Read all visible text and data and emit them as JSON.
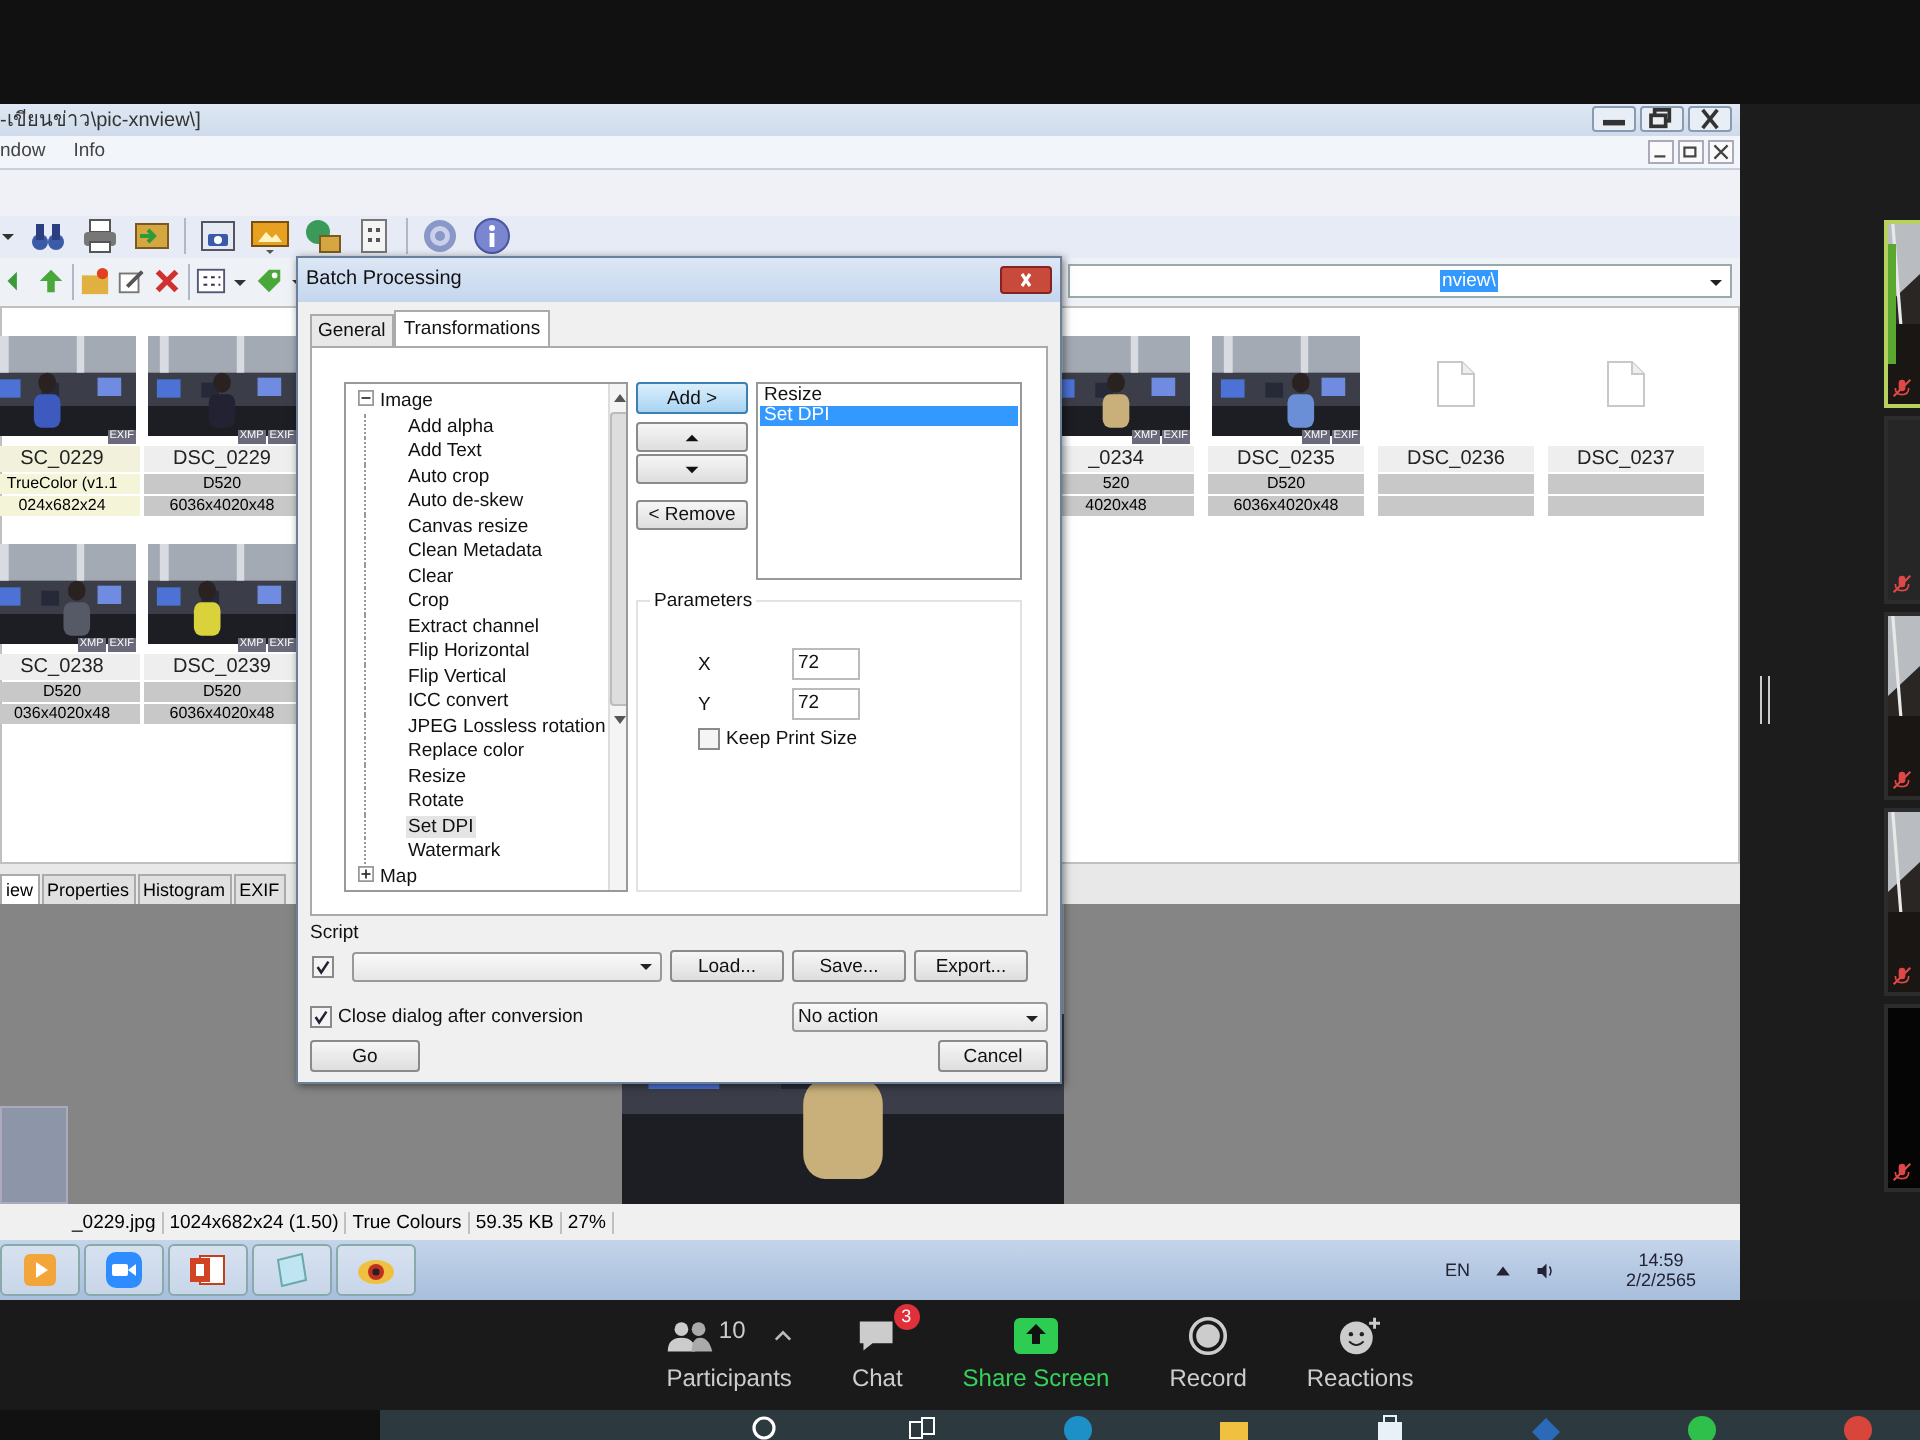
{
  "window": {
    "title": "-เขียนข่าว\\pic-xnview\\]"
  },
  "menu": [
    {
      "label": "ndow"
    },
    {
      "label": "Info"
    }
  ],
  "path": {
    "value": "nview\\"
  },
  "thumbnails_left": [
    {
      "name": "SC_0229",
      "line1": "TrueColor (v1.1",
      "line2": "024x682x24",
      "selected": true,
      "badges": [
        "EXIF"
      ]
    },
    {
      "name": "DSC_0229",
      "line1": "D520",
      "line2": "6036x4020x48",
      "selected": false,
      "badges": [
        "XMP",
        "EXIF"
      ]
    },
    {
      "name": "SC_0238",
      "line1": "D520",
      "line2": "036x4020x48",
      "selected": false,
      "badges": [
        "XMP",
        "EXIF"
      ]
    },
    {
      "name": "DSC_0239",
      "line1": "D520",
      "line2": "6036x4020x48",
      "selected": false,
      "badges": [
        "XMP",
        "EXIF"
      ]
    }
  ],
  "thumbnails_right": [
    {
      "name": "_0234",
      "line1": "520",
      "line2": "4020x48",
      "selected": false,
      "badges": [
        "XMP",
        "EXIF"
      ]
    },
    {
      "name": "DSC_0235",
      "line1": "D520",
      "line2": "6036x4020x48",
      "selected": false,
      "badges": [
        "XMP",
        "EXIF"
      ]
    },
    {
      "name": "DSC_0236",
      "kind": "file",
      "selected": false
    },
    {
      "name": "DSC_0237",
      "kind": "file",
      "selected": false
    }
  ],
  "panel_tabs": [
    {
      "label": "iew",
      "selected": true
    },
    {
      "label": "Properties",
      "selected": false
    },
    {
      "label": "Histogram",
      "selected": false
    },
    {
      "label": "EXIF",
      "selected": false
    }
  ],
  "status_bar": [
    "_0229.jpg",
    "1024x682x24 (1.50)",
    "True Colours",
    "59.35 KB",
    "27%"
  ],
  "taskbar": {
    "apps": [
      {
        "kind": "media"
      },
      {
        "kind": "meeting"
      },
      {
        "kind": "slides"
      },
      {
        "kind": "notes"
      },
      {
        "kind": "viewer"
      }
    ],
    "language": "EN",
    "time": "14:59",
    "date": "2/2/2565"
  },
  "dialog": {
    "title": "Batch Processing",
    "tabs": [
      {
        "label": "General",
        "selected": false
      },
      {
        "label": "Transformations",
        "selected": true
      }
    ],
    "tree": [
      {
        "label": "Image",
        "expanded": true,
        "children": [
          {
            "label": "Add alpha",
            "selected": false
          },
          {
            "label": "Add Text",
            "selected": false
          },
          {
            "label": "Auto crop",
            "selected": false
          },
          {
            "label": "Auto de-skew",
            "selected": false
          },
          {
            "label": "Canvas resize",
            "selected": false
          },
          {
            "label": "Clean Metadata",
            "selected": false
          },
          {
            "label": "Clear",
            "selected": false
          },
          {
            "label": "Crop",
            "selected": false
          },
          {
            "label": "Extract channel",
            "selected": false
          },
          {
            "label": "Flip Horizontal",
            "selected": false
          },
          {
            "label": "Flip Vertical",
            "selected": false
          },
          {
            "label": "ICC convert",
            "selected": false
          },
          {
            "label": "JPEG Lossless rotation",
            "selected": false
          },
          {
            "label": "Replace color",
            "selected": false
          },
          {
            "label": "Resize",
            "selected": false
          },
          {
            "label": "Rotate",
            "selected": false
          },
          {
            "label": "Set DPI",
            "selected": true
          },
          {
            "label": "Watermark",
            "selected": false
          }
        ]
      },
      {
        "label": "Map",
        "expanded": false
      }
    ],
    "add": "Add >",
    "remove": "< Remove",
    "queue": [
      {
        "label": "Resize",
        "selected": false
      },
      {
        "label": "Set DPI",
        "selected": true
      }
    ],
    "parameters": {
      "title": "Parameters",
      "fields": [
        {
          "label": "X",
          "value": "72"
        },
        {
          "label": "Y",
          "value": "72"
        }
      ],
      "keep_print_size": {
        "label": "Keep Print Size",
        "checked": false
      }
    },
    "script": {
      "label": "Script",
      "checked": true,
      "buttons": [
        "Load...",
        "Save...",
        "Export..."
      ]
    },
    "close_after": {
      "label": "Close dialog after conversion",
      "checked": true
    },
    "action": {
      "value": "No action"
    },
    "go": "Go",
    "cancel": "Cancel"
  },
  "zoom_toolbar": [
    {
      "kind": "participants",
      "label": "Participants",
      "count": "10"
    },
    {
      "kind": "chat",
      "label": "Chat",
      "badge": "3"
    },
    {
      "kind": "share",
      "label": "Share Screen"
    },
    {
      "kind": "record",
      "label": "Record"
    },
    {
      "kind": "reactions",
      "label": "Reactions"
    }
  ],
  "video_tiles": [
    {
      "kind": "picture",
      "active": true,
      "muted": true
    },
    {
      "kind": "blank",
      "active": false,
      "muted": true
    },
    {
      "kind": "picture",
      "active": false,
      "muted": true
    },
    {
      "kind": "picture",
      "active": false,
      "muted": true
    },
    {
      "kind": "dark",
      "active": false,
      "muted": true
    }
  ]
}
